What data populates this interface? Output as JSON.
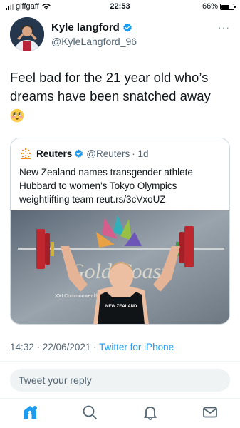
{
  "status_bar": {
    "carrier": "giffgaff",
    "time": "22:53",
    "battery": "66%",
    "battery_level": 0.66
  },
  "tweet": {
    "display_name": "Kyle langford",
    "handle": "@KyleLangford_96",
    "more": "···",
    "text": "Feel bad for the 21 year old who’s dreams have been snatched away",
    "emoji": "flushed-face-emoji",
    "timestamp": "14:32 · 22/06/2021 · ",
    "source": "Twitter for iPhone"
  },
  "quote": {
    "name": "Reuters",
    "handle": "@Reuters",
    "age": "· 1d",
    "text": "New Zealand names transgender athlete Hubbard to women's Tokyo Olympics weightlifting team reut.rs/3cVxoUZ",
    "image_text": {
      "backdrop_logo": "Gold Coast",
      "backdrop_small": "XXI Commonwealth",
      "shirt": "NEW ZEALAND"
    }
  },
  "reply": {
    "placeholder": "Tweet your reply"
  },
  "tabs": [
    {
      "name": "home",
      "icon": "home-icon"
    },
    {
      "name": "search",
      "icon": "search-icon"
    },
    {
      "name": "notifications",
      "icon": "bell-icon"
    },
    {
      "name": "messages",
      "icon": "mail-icon"
    }
  ],
  "colors": {
    "accent": "#1d9bf0",
    "text": "#0f1419",
    "secondary": "#536471",
    "border": "#cfd9de"
  }
}
